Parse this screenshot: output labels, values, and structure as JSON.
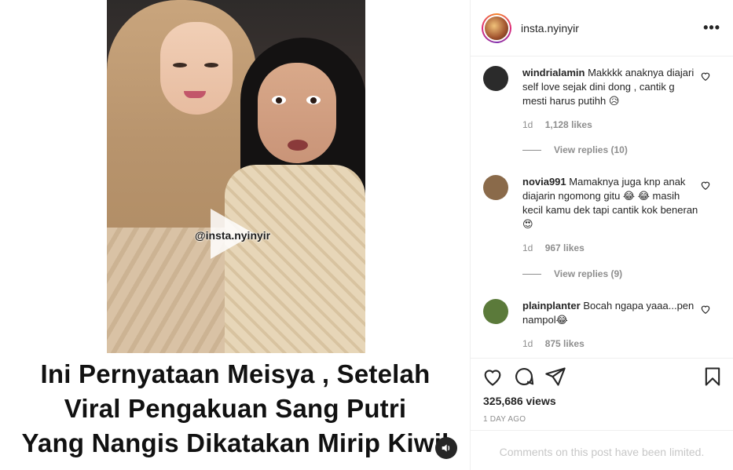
{
  "post": {
    "watermark": "@insta.nyinyir",
    "caption_lines": [
      "Ini Pernyataan Meisya , Setelah",
      "Viral Pengakuan Sang Putri",
      "Yang Nangis Dikatakan Mirip Kiwil"
    ]
  },
  "header": {
    "username": "insta.nyinyir",
    "more_label": "•••"
  },
  "comments": [
    {
      "username": "windrialamin",
      "text": "Makkkk anaknya diajari self love sejak dini dong , cantik g mesti harus putihh 😥",
      "age": "1d",
      "likes": "1,128 likes",
      "view_replies": "View replies (10)",
      "avatar_color": "#2b2b2b"
    },
    {
      "username": "novia991",
      "text": "Mamaknya juga knp anak diajarin ngomong gitu 😂 😂 masih kecil kamu dek tapi cantik kok beneran😍",
      "age": "1d",
      "likes": "967 likes",
      "view_replies": "View replies (9)",
      "avatar_color": "#8a6a4a"
    },
    {
      "username": "plainplanter",
      "text": "Bocah ngapa yaaa...pen nampol😂",
      "age": "1d",
      "likes": "875 likes",
      "avatar_color": "#5b7a3a"
    }
  ],
  "stats": {
    "views": "325,686 views",
    "posted": "1 DAY AGO"
  },
  "footer": {
    "limited_text": "Comments on this post have been limited."
  },
  "icons": {
    "like": "heart-icon",
    "comment": "comment-icon",
    "share": "paper-plane-icon",
    "save": "bookmark-icon",
    "sound": "speaker-icon"
  }
}
